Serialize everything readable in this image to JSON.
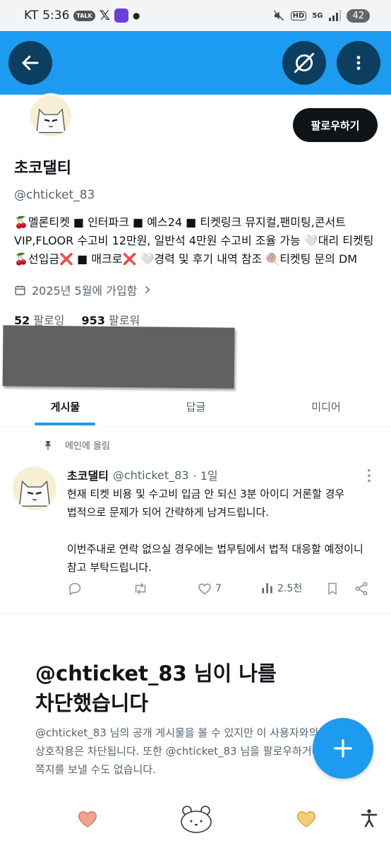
{
  "status_bar": {
    "carrier": "KT",
    "time": "5:36",
    "talk_badge": "TALK",
    "hd": "HD",
    "network": "5G",
    "battery": "42"
  },
  "header": {
    "back_icon": "arrow-left-icon",
    "grok_icon": "grok-icon",
    "more_icon": "more-vertical-icon"
  },
  "profile": {
    "follow_label": "팔로우하기",
    "display_name": "초코댈티",
    "handle": "@chticket_83",
    "bio_line1": "🍒멜론티켓 ■ 인터파크 ■ 예스24 ■ 티켓링크 뮤지컬,팬미팅,콘서트",
    "bio_line2": "VIP,FLOOR 수고비 12만원, 일반석 4만원 수고비 조율 가능 🤍대리 티켓팅",
    "bio_line3": "🍒선입금❌ ■ 매크로❌ 🤍경력 및 후기 내역 참조 🍭티켓팅 문의 DM",
    "joined": "2025년 5월에 가입함",
    "following_count": "52",
    "following_label": "팔로잉",
    "followers_count": "953",
    "followers_label": "팔로워"
  },
  "tabs": [
    {
      "label": "게시물"
    },
    {
      "label": "답글"
    },
    {
      "label": "미디어"
    }
  ],
  "post": {
    "pinned_label": "메인에 올림",
    "author": "초코댈티",
    "handle": "@chticket_83",
    "time": "· 1일",
    "line1": "현재 티켓 비용 및 수고비 입금 안 되신 3분 아이디 거론할 경우",
    "line2": "법적으로 문제가 되어 간략하게 남겨드립니다.",
    "line3": "이번주내로 연락 없으실 경우에는 법무팀에서 법적 대응할 예정이니",
    "line4": "참고 부탁드립니다.",
    "likes": "7",
    "views": "2.5천"
  },
  "blocked": {
    "title_line1": "@chticket_83 님이 나를",
    "title_line2": "차단했습니다",
    "desc_line1": "@chticket_83 님의 공개 게시물을 볼 수 있지만 이 사용자와의",
    "desc_line2": "상호작용은 차단됩니다. 또한 @chticket_83 님을 팔로우하거나",
    "desc_line3": "쪽지를 보낼 수도 없습니다."
  },
  "colors": {
    "accent": "#1d9bf0",
    "header_button": "#0b3e5f",
    "text": "#0f1419",
    "muted": "#536471"
  }
}
